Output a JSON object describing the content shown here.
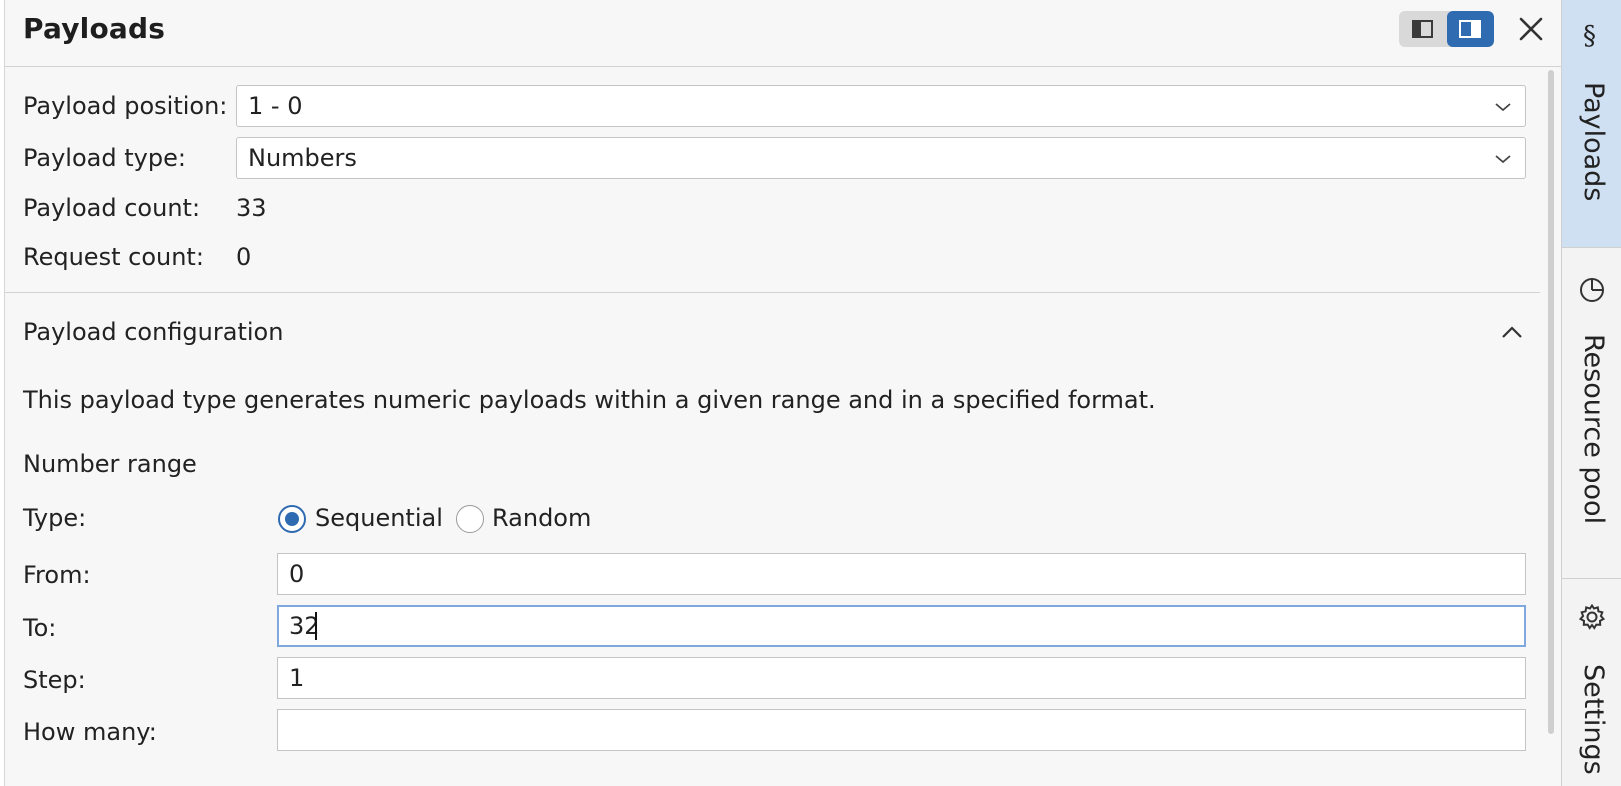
{
  "panel": {
    "title": "Payloads",
    "layout_toggle": {
      "left_icon": "sidebar-left-icon",
      "right_icon": "sidebar-right-icon",
      "active": "right"
    },
    "close_icon": "close-icon"
  },
  "summary": {
    "position_label": "Payload position:",
    "position_value": "1 - 0",
    "type_label": "Payload type:",
    "type_value": "Numbers",
    "count_label": "Payload count:",
    "count_value": "33",
    "request_label": "Request count:",
    "request_value": "0"
  },
  "config": {
    "title": "Payload configuration",
    "description": "This payload type generates numeric payloads within a given range and in a specified format.",
    "range_heading": "Number range",
    "type_label": "Type:",
    "sequential_label": "Sequential",
    "random_label": "Random",
    "selected_type": "Sequential",
    "from_label": "From:",
    "from_value": "0",
    "to_label": "To:",
    "to_value": "32",
    "step_label": "Step:",
    "step_value": "1",
    "howmany_label": "How many:",
    "howmany_value": ""
  },
  "side_tabs": [
    {
      "label": "Payloads",
      "icon": "payloads-icon",
      "active": true
    },
    {
      "label": "Resource pool",
      "icon": "resource-pool-icon",
      "active": false
    },
    {
      "label": "Settings",
      "icon": "gear-icon",
      "active": false
    }
  ],
  "colors": {
    "accent": "#2f6bb1",
    "active_tab_bg": "#cfe0f3",
    "focus_border": "#7fa9de"
  }
}
